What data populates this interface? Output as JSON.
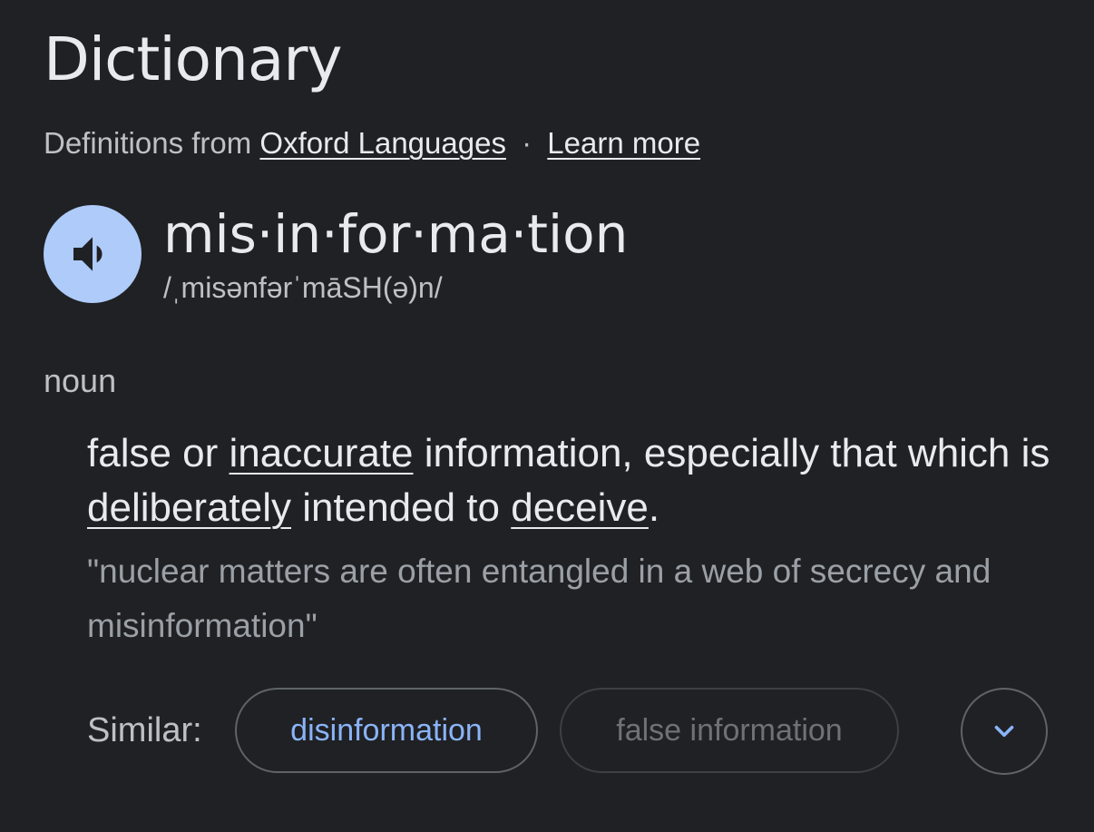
{
  "header": {
    "title": "Dictionary",
    "source_prefix": "Definitions from",
    "source_link": "Oxford Languages",
    "separator": "·",
    "learn_more": "Learn more"
  },
  "entry": {
    "headword": "mis·in·for·ma·tion",
    "phonetic": "/ˌmisənfərˈmāSH(ə)n/",
    "part_of_speech": "noun",
    "definition": {
      "t1": "false or ",
      "l1": "inaccurate",
      "t2": " information, especially that which is ",
      "l2": "deliberately",
      "t3": " intended to ",
      "l3": "deceive",
      "t4": "."
    },
    "example": "\"nuclear matters are often entangled in a web of secrecy and misinformation\""
  },
  "similar": {
    "label": "Similar:",
    "chips": [
      "disinformation",
      "false information"
    ]
  },
  "icons": {
    "audio": "speaker-icon",
    "expand": "chevron-down-icon"
  },
  "colors": {
    "background": "#202124",
    "accent": "#8ab4f8",
    "audio_button": "#aecbfa"
  }
}
